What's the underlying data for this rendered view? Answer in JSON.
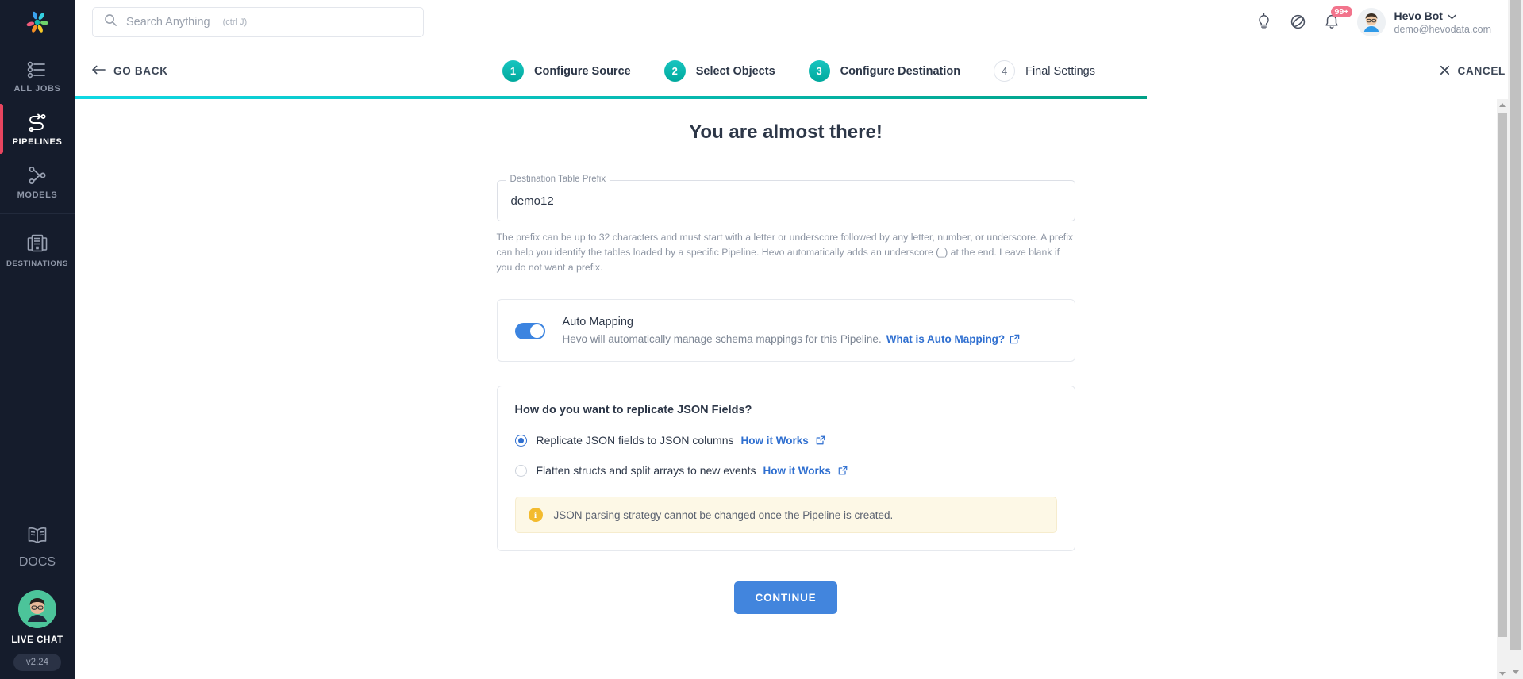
{
  "sidebar": {
    "logo_icon": "hevo-logo-icon",
    "items": [
      {
        "label": "All Jobs",
        "icon": "list-icon",
        "active": false
      },
      {
        "label": "Pipelines",
        "icon": "pipelines-icon",
        "active": true
      },
      {
        "label": "Models",
        "icon": "models-icon",
        "active": false
      },
      {
        "label": "Destinations",
        "icon": "destinations-icon",
        "active": false
      }
    ],
    "docs_label": "DOCS",
    "docs_icon": "book-icon",
    "live_chat_label": "LIVE CHAT",
    "version": "v2.24",
    "active_indicator_color": "#e8455f"
  },
  "topbar": {
    "search": {
      "placeholder": "Search Anything",
      "shortcut": "(ctrl J)",
      "value": ""
    },
    "icons": [
      {
        "name": "lightbulb-icon"
      },
      {
        "name": "compass-icon"
      },
      {
        "name": "bell-icon",
        "badge": "99+"
      }
    ],
    "user": {
      "name": "Hevo Bot",
      "email": "demo@hevodata.com"
    }
  },
  "stepbar": {
    "go_back_label": "GO BACK",
    "cancel_label": "CANCEL",
    "steps": [
      {
        "num": "1",
        "label": "Configure Source",
        "state": "done"
      },
      {
        "num": "2",
        "label": "Select Objects",
        "state": "done"
      },
      {
        "num": "3",
        "label": "Configure Destination",
        "state": "done"
      },
      {
        "num": "4",
        "label": "Final Settings",
        "state": "pending"
      }
    ],
    "progress_percent": 74,
    "progress_color_start": "#0fd8e4",
    "progress_color_end": "#00a187"
  },
  "main": {
    "title": "You are almost there!",
    "prefix_field": {
      "label": "Destination Table Prefix",
      "value": "demo12",
      "placeholder": ""
    },
    "prefix_help": "The prefix can be up to 32 characters and must start with a letter or underscore followed by any letter, number, or underscore. A prefix can help you identify the tables loaded by a specific Pipeline. Hevo automatically adds an underscore (_) at the end. Leave blank if you do not want a prefix.",
    "auto_mapping": {
      "title": "Auto Mapping",
      "description": "Hevo will automatically manage schema mappings for this Pipeline.",
      "link_label": "What is Auto Mapping?",
      "enabled": true,
      "toggle_color": "#3c84e0"
    },
    "json_fields": {
      "question": "How do you want to replicate JSON Fields?",
      "options": [
        {
          "label": "Replicate JSON fields to JSON columns",
          "link_label": "How it Works",
          "selected": true
        },
        {
          "label": "Flatten structs and split arrays to new events",
          "link_label": "How it Works",
          "selected": false
        }
      ],
      "info_icon": "info-circle-icon",
      "info_text": "JSON parsing strategy cannot be changed once the Pipeline is created.",
      "info_bg": "#fdf8e6",
      "info_icon_color": "#f3bb2e"
    },
    "continue_label": "CONTINUE",
    "continue_color": "#4285dd"
  }
}
